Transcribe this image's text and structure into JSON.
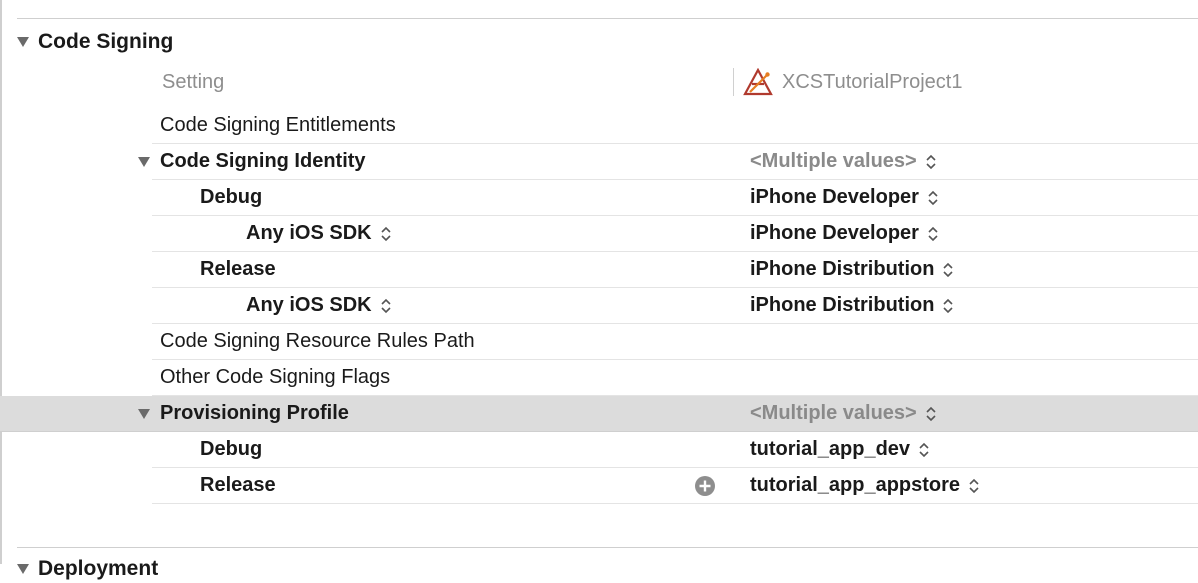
{
  "section": {
    "title": "Code Signing",
    "next_title_partial": "Deployment"
  },
  "columns": {
    "setting": "Setting",
    "target": "XCSTutorialProject1"
  },
  "rows": [
    {
      "name": "Code Signing Entitlements",
      "value": ""
    },
    {
      "name": "Code Signing Identity",
      "value": "<Multiple values>"
    },
    {
      "name": "Debug",
      "value": "iPhone Developer"
    },
    {
      "name": "Any iOS SDK",
      "value": "iPhone Developer"
    },
    {
      "name": "Release",
      "value": "iPhone Distribution"
    },
    {
      "name": "Any iOS SDK",
      "value": "iPhone Distribution"
    },
    {
      "name": "Code Signing Resource Rules Path",
      "value": ""
    },
    {
      "name": "Other Code Signing Flags",
      "value": ""
    },
    {
      "name": "Provisioning Profile",
      "value": "<Multiple values>"
    },
    {
      "name": "Debug",
      "value": "tutorial_app_dev"
    },
    {
      "name": "Release",
      "value": "tutorial_app_appstore"
    }
  ],
  "icons": {
    "section_toggle": "disclosure-triangle-icon",
    "target": "xcode-app-icon",
    "stepper": "up-down-chevron-icon",
    "add": "plus-circle-icon"
  },
  "colors": {
    "selected_row": "#dcdcdc",
    "muted_text": "#8a8a8a",
    "divider": "#e4e4e4",
    "accent_target": "#c0392b"
  }
}
